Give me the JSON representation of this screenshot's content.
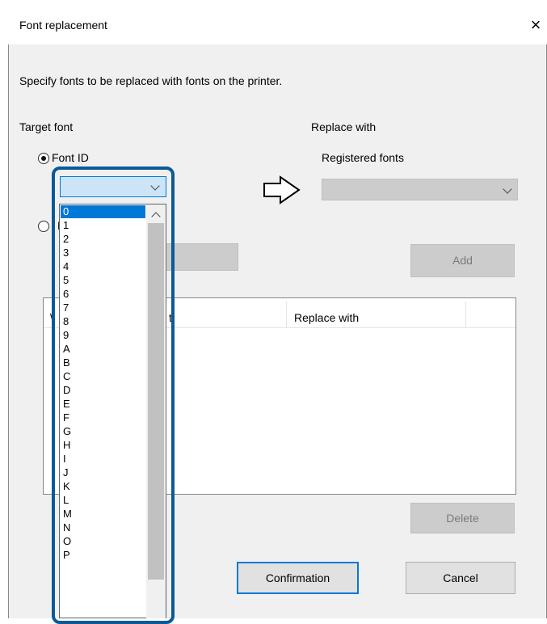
{
  "dialog": {
    "title": "Font replacement",
    "close_icon": "×",
    "instruction": "Specify fonts to be replaced with fonts on the printer."
  },
  "target_font": {
    "label": "Target font",
    "font_id_label": "Font ID",
    "font_id_selected": true,
    "second_radio_visible_text": "F"
  },
  "replace_with": {
    "label": "Replace with",
    "registered_fonts_label": "Registered fonts",
    "add_label": "Add"
  },
  "font_list": {
    "col_target_partial": "t:",
    "col_replace": "Replace with",
    "hidden_header_char": "\\"
  },
  "buttons": {
    "delete": "Delete",
    "confirmation": "Confirmation",
    "cancel": "Cancel"
  },
  "dropdown": {
    "selected_index": 0,
    "items": [
      "0",
      "1",
      "2",
      "3",
      "4",
      "5",
      "6",
      "7",
      "8",
      "9",
      "A",
      "B",
      "C",
      "D",
      "E",
      "F",
      "G",
      "H",
      "I",
      "J",
      "K",
      "L",
      "M",
      "N",
      "O",
      "P"
    ]
  },
  "colors": {
    "selection": "#0078d7",
    "highlight_border": "#0b5a97",
    "dialog_bg": "#f0f0f0"
  }
}
